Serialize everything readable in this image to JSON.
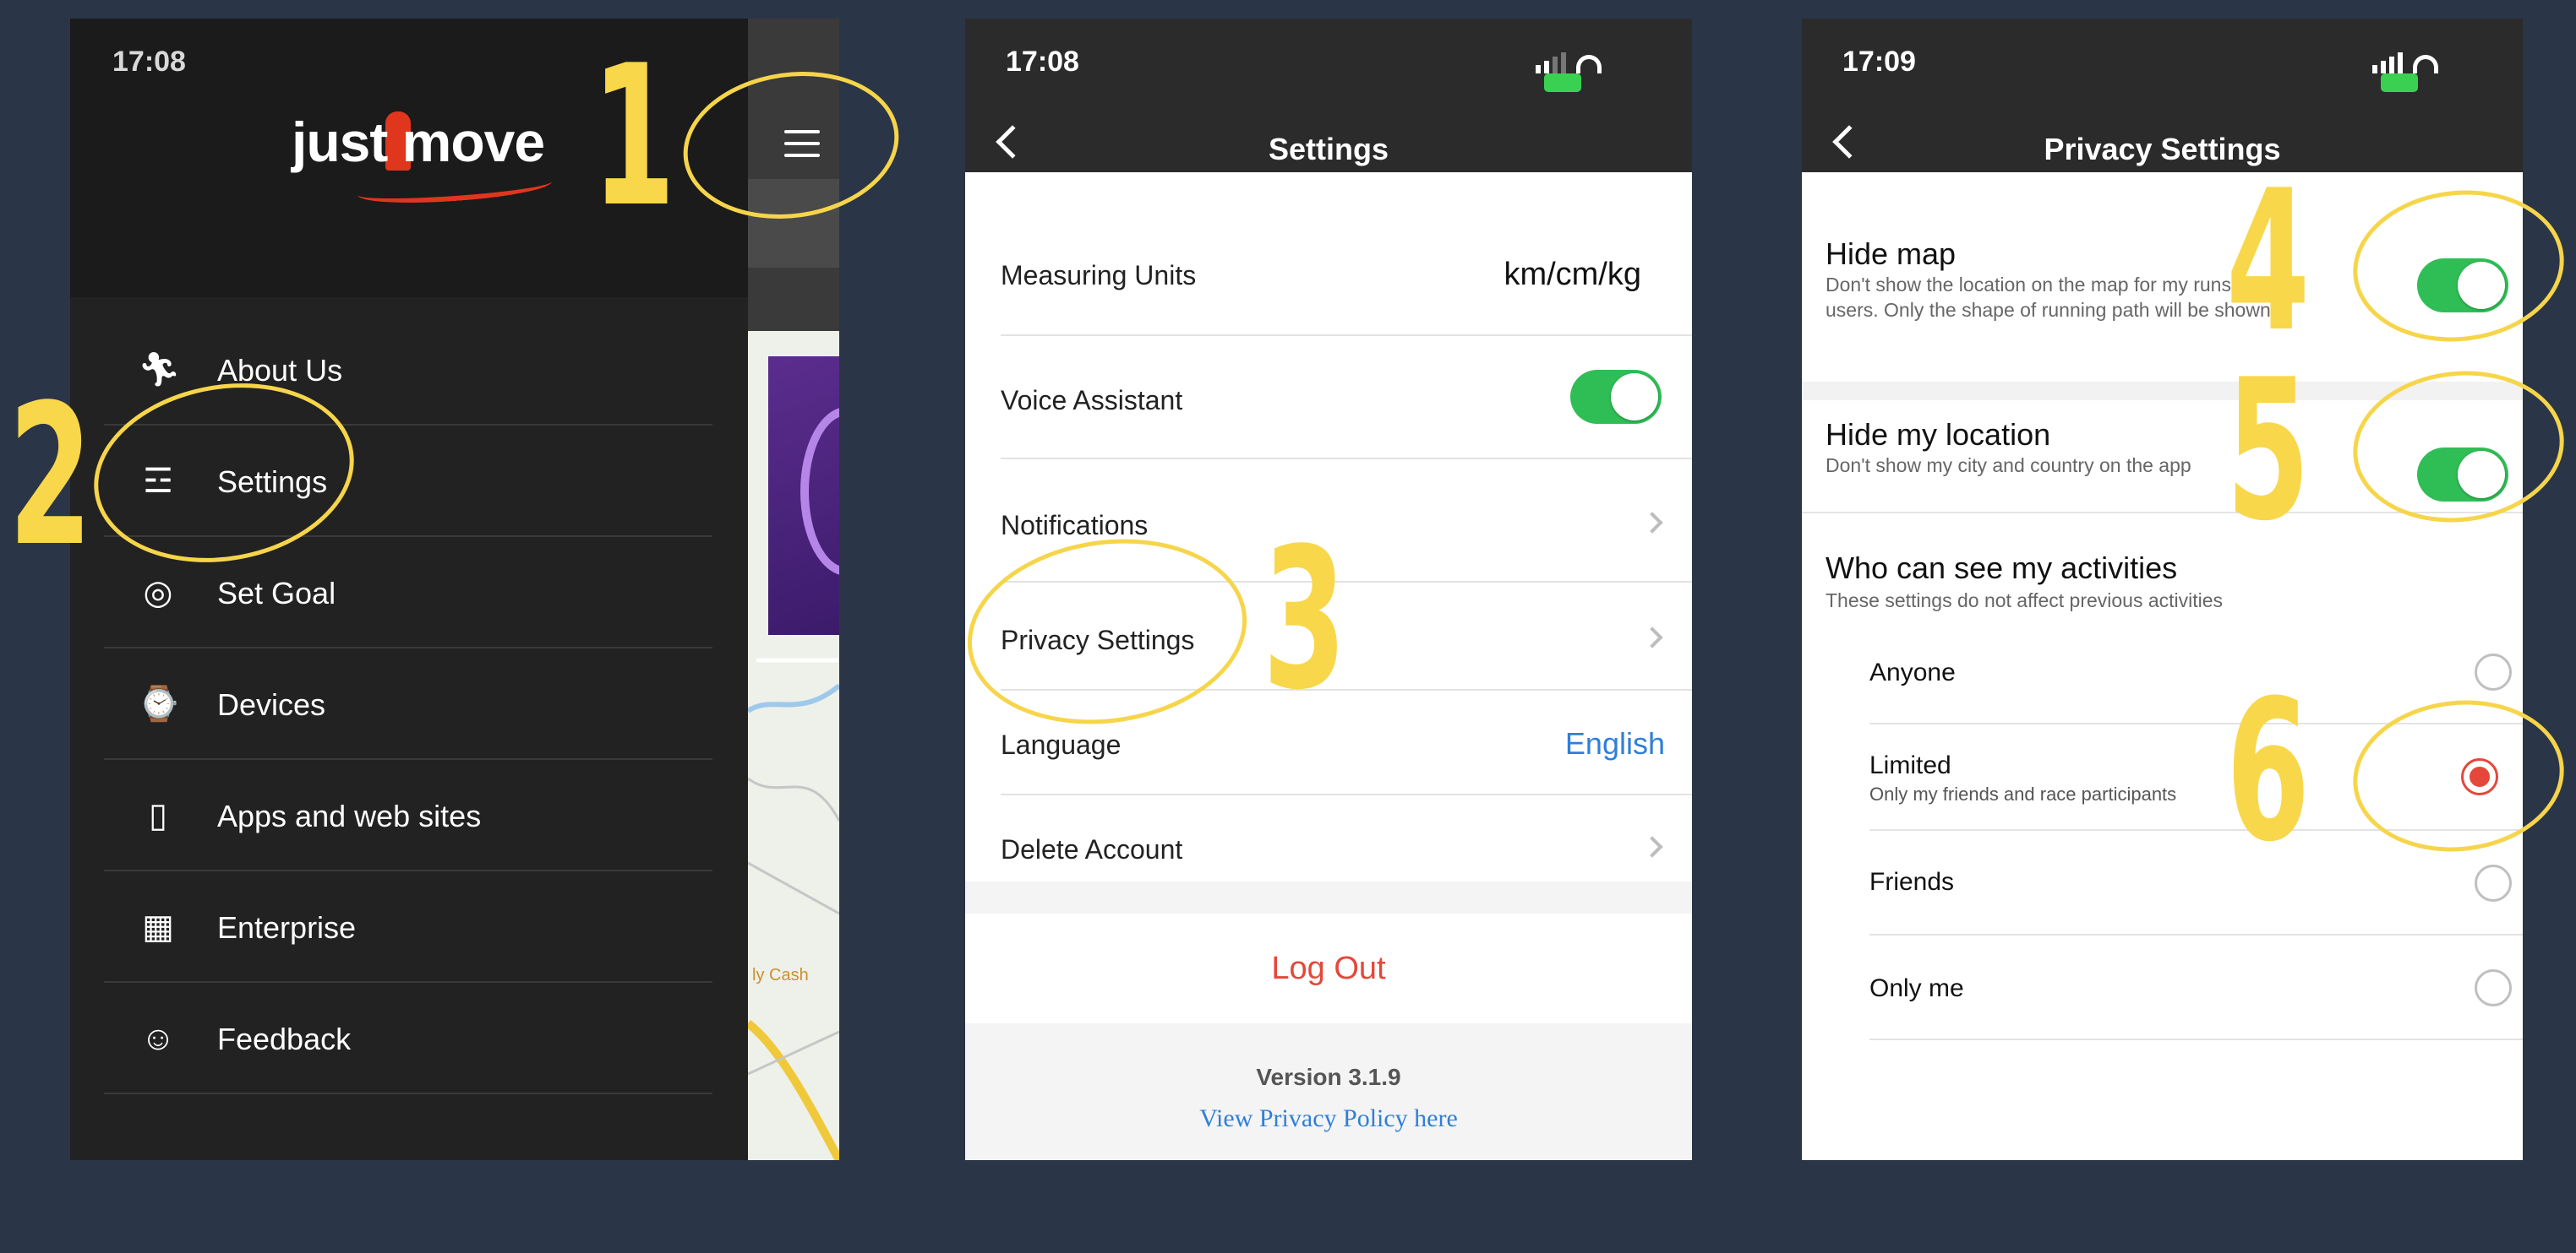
{
  "colors": {
    "background": "#2b3548",
    "annotation": "#f8d74a",
    "toggle_on": "#2fbe55",
    "accent_red": "#e5473a",
    "link_blue": "#2f7fd8"
  },
  "annotations": [
    "1",
    "2",
    "3",
    "4",
    "5",
    "6"
  ],
  "phone1": {
    "status_time": "17:08",
    "logo_text": "just move",
    "menu_icon": "hamburger-icon",
    "map_label": "ly Cash",
    "menu": [
      {
        "label": "About Us",
        "icon": "runner-icon"
      },
      {
        "label": "Settings",
        "icon": "sliders-icon"
      },
      {
        "label": "Set Goal",
        "icon": "target-icon"
      },
      {
        "label": "Devices",
        "icon": "watch-icon"
      },
      {
        "label": "Apps and web sites",
        "icon": "phone-icon"
      },
      {
        "label": "Enterprise",
        "icon": "building-icon"
      },
      {
        "label": "Feedback",
        "icon": "smiley-icon"
      }
    ]
  },
  "phone2": {
    "status_time": "17:08",
    "title": "Settings",
    "rows": {
      "units_label": "Measuring Units",
      "units_value": "km/cm/kg",
      "voice_label": "Voice Assistant",
      "voice_on": true,
      "notifications_label": "Notifications",
      "privacy_label": "Privacy Settings",
      "language_label": "Language",
      "language_value": "English",
      "delete_label": "Delete Account"
    },
    "logout_label": "Log Out",
    "version": "Version 3.1.9",
    "privacy_link": "View Privacy Policy here"
  },
  "phone3": {
    "status_time": "17:09",
    "title": "Privacy Settings",
    "hide_map": {
      "title": "Hide map",
      "desc": "Don't show the location on the  map for my runs to other users. Only the shape of running path will be shown.",
      "on": true
    },
    "hide_location": {
      "title": "Hide my location",
      "desc": "Don't show my city and country on the app",
      "on": true
    },
    "activities": {
      "title": "Who can see my activities",
      "desc": "These settings do not affect previous activities",
      "options": [
        {
          "label": "Anyone",
          "sub": "",
          "selected": false
        },
        {
          "label": "Limited",
          "sub": "Only my friends and race participants",
          "selected": true
        },
        {
          "label": "Friends",
          "sub": "",
          "selected": false
        },
        {
          "label": "Only me",
          "sub": "",
          "selected": false
        }
      ]
    }
  }
}
